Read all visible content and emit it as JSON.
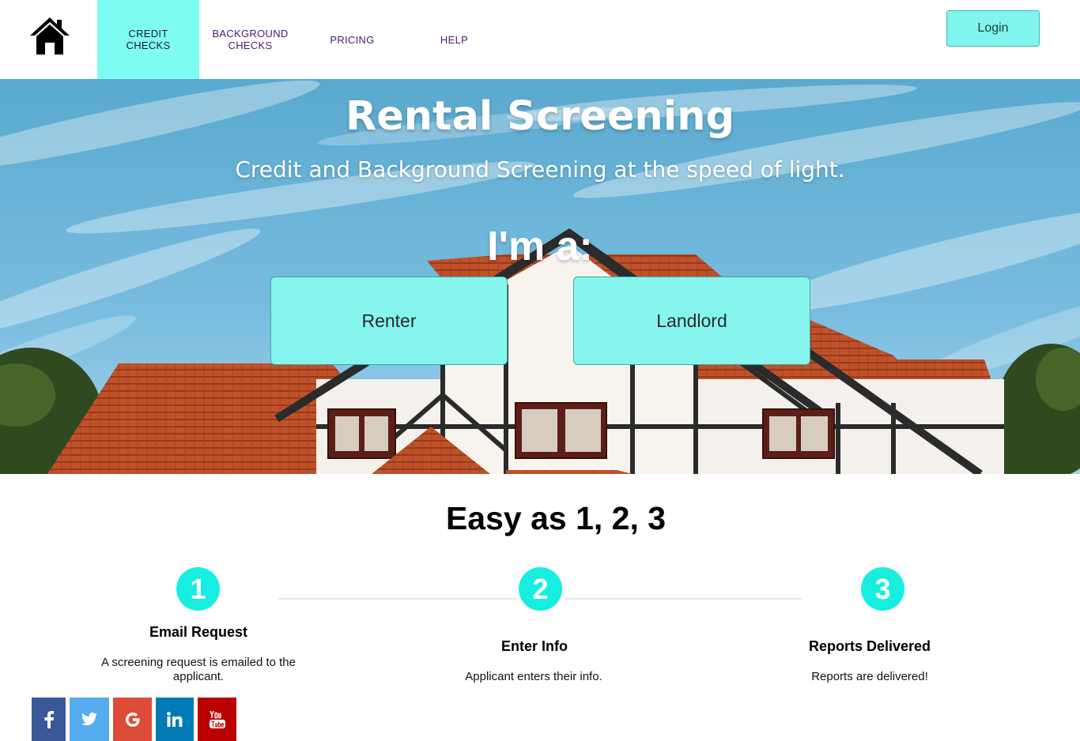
{
  "nav": {
    "logo_icon": "home-icon",
    "items": [
      {
        "label": "CREDIT\nCHECKS",
        "active": true
      },
      {
        "label": "BACKGROUND\nCHECKS",
        "active": false
      },
      {
        "label": "PRICING",
        "active": false
      },
      {
        "label": "HELP",
        "active": false
      }
    ],
    "login_label": "Login"
  },
  "hero": {
    "title": "Rental Screening",
    "subtitle": "Credit and Background Screening at the speed of light.",
    "prompt": "I'm a:",
    "renter_label": "Renter",
    "landlord_label": "Landlord"
  },
  "steps": {
    "heading": "Easy as 1, 2, 3",
    "items": [
      {
        "number": "1",
        "title": "Email Request",
        "description": "A screening request is emailed to the applicant."
      },
      {
        "number": "2",
        "title": "Enter Info",
        "description": "Applicant enters their info."
      },
      {
        "number": "3",
        "title": "Reports Delivered",
        "description": "Reports are delivered!"
      }
    ]
  },
  "social": [
    {
      "icon": "facebook-icon",
      "color": "#3b5998"
    },
    {
      "icon": "twitter-icon",
      "color": "#55acee"
    },
    {
      "icon": "google-plus-icon",
      "color": "#dd4b39"
    },
    {
      "icon": "linkedin-icon",
      "color": "#007bb5"
    },
    {
      "icon": "youtube-icon",
      "color": "#bb0000"
    }
  ],
  "colors": {
    "accent": "#7ffdf3",
    "step_circle": "#17eee0",
    "nav_text": "#4b1a73"
  }
}
